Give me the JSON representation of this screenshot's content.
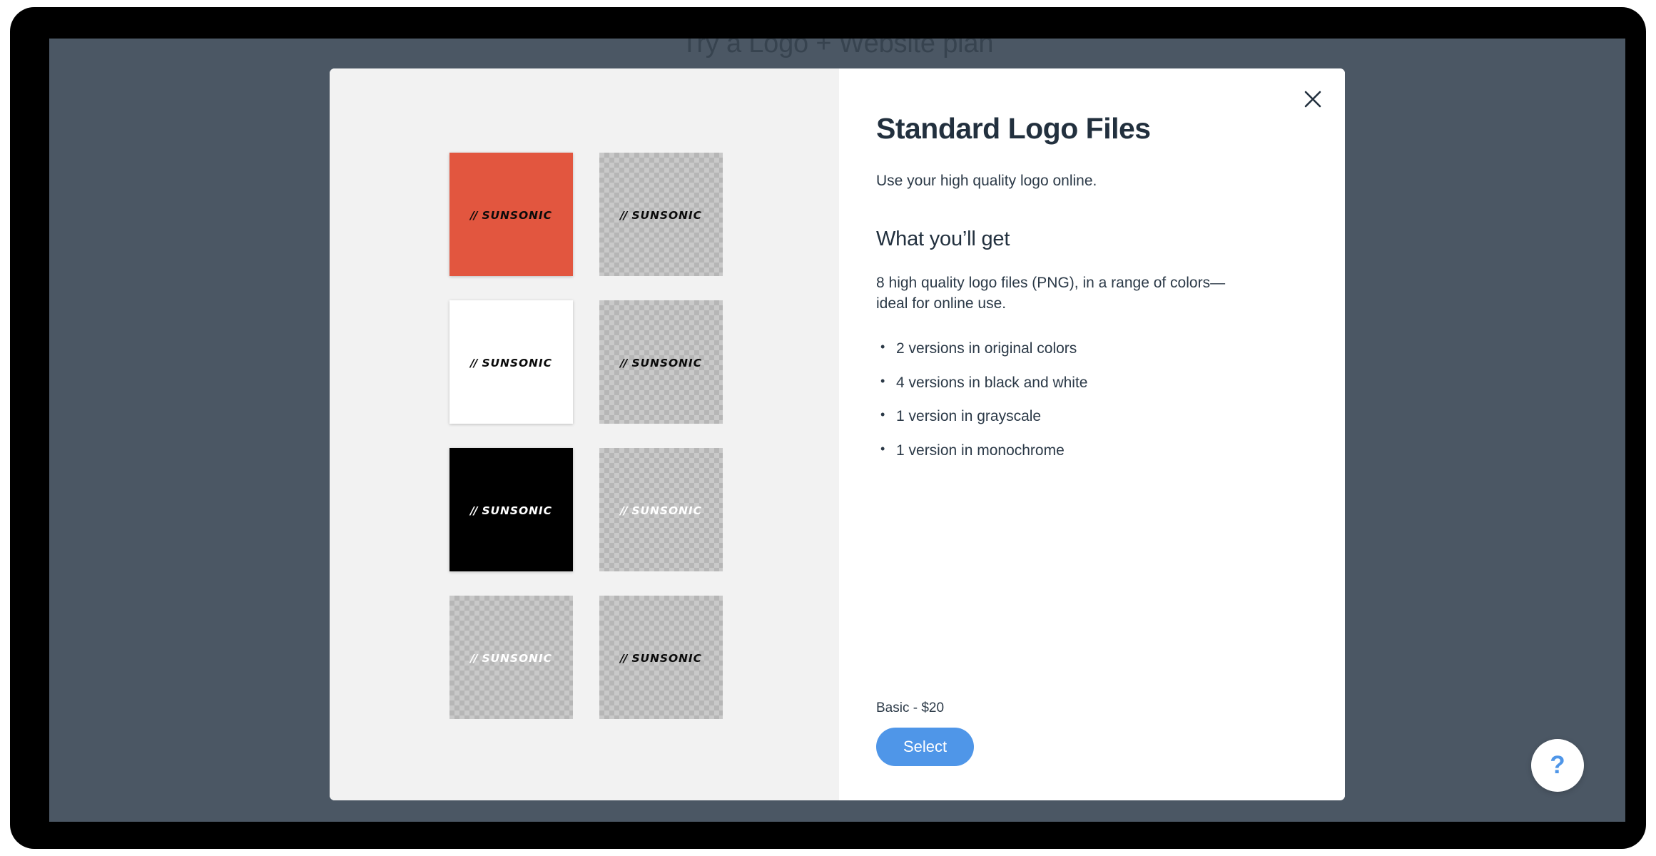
{
  "background_page": {
    "heading": "Try a Logo + Website plan"
  },
  "modal": {
    "close_icon": "close-icon",
    "title": "Standard Logo Files",
    "subtitle": "Use your high quality logo online.",
    "section_heading": "What you’ll get",
    "section_body": "8 high quality logo files (PNG), in a range of colors—ideal for online use.",
    "features": [
      "2 versions in original colors",
      "4 versions in black and white",
      "1 version in grayscale",
      "1 version in monochrome"
    ],
    "price_label": "Basic - $20",
    "select_label": "Select",
    "preview": {
      "logo_text": "SUNSONIC",
      "logo_mark": "//",
      "tiles": [
        {
          "background": "#e2563f",
          "background_kind": "solid",
          "logo_color": "#0a0a0a",
          "shadow": true
        },
        {
          "background": "",
          "background_kind": "transparent",
          "logo_color": "#0a0a0a",
          "shadow": false
        },
        {
          "background": "#ffffff",
          "background_kind": "solid",
          "logo_color": "#0a0a0a",
          "shadow": true
        },
        {
          "background": "",
          "background_kind": "transparent",
          "logo_color": "#0a0a0a",
          "shadow": false
        },
        {
          "background": "#000000",
          "background_kind": "solid",
          "logo_color": "#ffffff",
          "shadow": true
        },
        {
          "background": "",
          "background_kind": "transparent",
          "logo_color": "#ffffff",
          "shadow": false
        },
        {
          "background": "",
          "background_kind": "transparent",
          "logo_color": "#ffffff",
          "shadow": false
        },
        {
          "background": "",
          "background_kind": "transparent",
          "logo_color": "#0a0a0a",
          "shadow": false
        }
      ]
    }
  },
  "help_button": {
    "label": "?",
    "color": "#4f96e8"
  },
  "colors": {
    "page_background": "#4b5764",
    "bezel": "#000000",
    "modal_left_panel": "#f2f2f2",
    "accent_blue": "#4f96e8",
    "brand_orange": "#e2563f",
    "text_dark": "#22303e"
  }
}
